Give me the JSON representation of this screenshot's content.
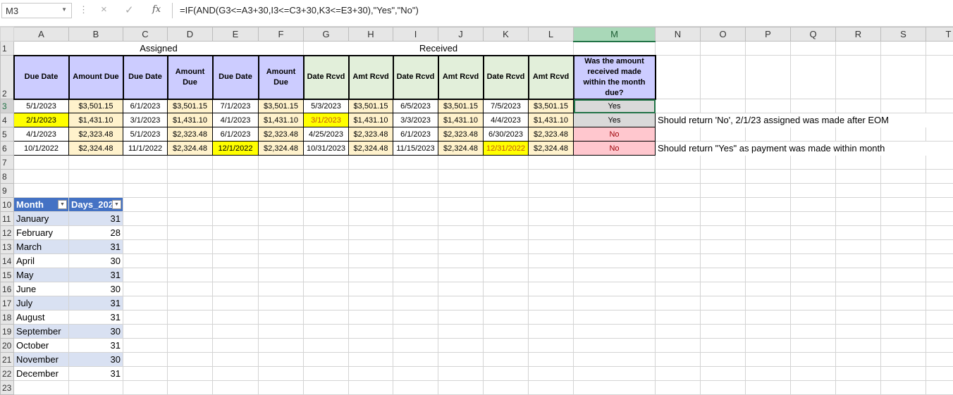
{
  "formula_bar": {
    "name_box": "M3",
    "formula": "=IF(AND(G3<=A3+30,I3<=C3+30,K3<=E3+30),\"Yes\",\"No\")",
    "cancel_icon": "×",
    "enter_icon": "✓",
    "fx_icon": "fx"
  },
  "columns": [
    "A",
    "B",
    "C",
    "D",
    "E",
    "F",
    "G",
    "H",
    "I",
    "J",
    "K",
    "L",
    "M",
    "N",
    "O",
    "P",
    "Q",
    "R",
    "S",
    "T"
  ],
  "selected_column": "M",
  "selected_row": 3,
  "sections": {
    "assigned": "Assigned",
    "received": "Received"
  },
  "headers": [
    "Due Date",
    "Amount Due",
    "Due Date",
    "Amount Due",
    "Due Date",
    "Amount Due",
    "Date Rcvd",
    "Amt Rcvd",
    "Date Rcvd",
    "Amt Rcvd",
    "Date Rcvd",
    "Amt Rcvd",
    "Was the amount received made within the month due?"
  ],
  "rows": [
    [
      "5/1/2023",
      "$3,501.15",
      "6/1/2023",
      "$3,501.15",
      "7/1/2023",
      "$3,501.15",
      "5/3/2023",
      "$3,501.15",
      "6/5/2023",
      "$3,501.15",
      "7/5/2023",
      "$3,501.15",
      "Yes"
    ],
    [
      "2/1/2023",
      "$1,431.10",
      "3/1/2023",
      "$1,431.10",
      "4/1/2023",
      "$1,431.10",
      "3/1/2023",
      "$1,431.10",
      "3/3/2023",
      "$1,431.10",
      "4/4/2023",
      "$1,431.10",
      "Yes"
    ],
    [
      "4/1/2023",
      "$2,323.48",
      "5/1/2023",
      "$2,323.48",
      "6/1/2023",
      "$2,323.48",
      "4/25/2023",
      "$2,323.48",
      "6/1/2023",
      "$2,323.48",
      "6/30/2023",
      "$2,323.48",
      "No"
    ],
    [
      "10/1/2022",
      "$2,324.48",
      "11/1/2022",
      "$2,324.48",
      "12/1/2022",
      "$2,324.48",
      "10/31/2023",
      "$2,324.48",
      "11/15/2023",
      "$2,324.48",
      "12/31/2022",
      "$2,324.48",
      "No"
    ]
  ],
  "notes": {
    "4": "Should return 'No', 2/1/23 assigned was made after EOM",
    "6": "Should return \"Yes\" as payment was made within month"
  },
  "month_table": {
    "headers": [
      "Month",
      "Days_202"
    ],
    "rows": [
      [
        "January",
        "31"
      ],
      [
        "February",
        "28"
      ],
      [
        "March",
        "31"
      ],
      [
        "April",
        "30"
      ],
      [
        "May",
        "31"
      ],
      [
        "June",
        "30"
      ],
      [
        "July",
        "31"
      ],
      [
        "August",
        "31"
      ],
      [
        "September",
        "30"
      ],
      [
        "October",
        "31"
      ],
      [
        "November",
        "30"
      ],
      [
        "December",
        "31"
      ]
    ]
  },
  "colors": {
    "assigned_header": "#ccccff",
    "received_header": "#e2efda",
    "amount_fill": "#fff2cc",
    "highlight": "#ffff00",
    "no_fill": "#ffc7ce",
    "table_header": "#4472c4"
  }
}
